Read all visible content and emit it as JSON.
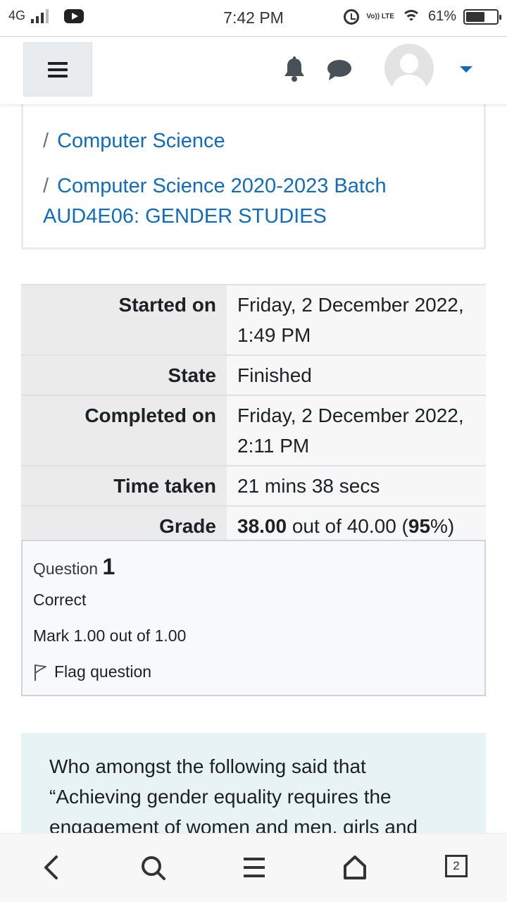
{
  "status_bar": {
    "network": "4G",
    "time": "7:42 PM",
    "volte": "Vo)) LTE",
    "battery": "61%",
    "battery_level": 0.61
  },
  "navbar": {
    "menu_icon": "hamburger-icon",
    "notification_icon": "bell-icon",
    "messages_icon": "chat-icon",
    "user_icon": "avatar",
    "dropdown_icon": "caret-down-icon",
    "accent_color": "#0f6cbf"
  },
  "breadcrumb": {
    "separator": "/",
    "items": [
      "Computer Science",
      "Computer Science 2020-2023 Batch",
      "AUD4E06: GENDER STUDIES"
    ]
  },
  "summary": {
    "rows": [
      {
        "label": "Started on",
        "value": "Friday, 2 December 2022, 1:49 PM"
      },
      {
        "label": "State",
        "value": "Finished"
      },
      {
        "label": "Completed on",
        "value": "Friday, 2 December 2022, 2:11 PM"
      },
      {
        "label": "Time taken",
        "value": "21 mins 38 secs"
      }
    ],
    "grade": {
      "label": "Grade",
      "score": "38.00",
      "middle": " out of 40.00 (",
      "percent": "95",
      "suffix": "%)"
    }
  },
  "question": {
    "label": "Question",
    "number": "1",
    "state": "Correct",
    "mark": "Mark 1.00 out of 1.00",
    "flag_label": "Flag question",
    "text": "Who amongst the following said that “Achieving gender equality requires the engagement of women and men, girls and"
  },
  "bottom_bar": {
    "back_icon": "back-chevron-icon",
    "search_icon": "search-icon",
    "menu_icon": "menu-icon",
    "home_icon": "home-icon",
    "tabs_count": "2"
  }
}
